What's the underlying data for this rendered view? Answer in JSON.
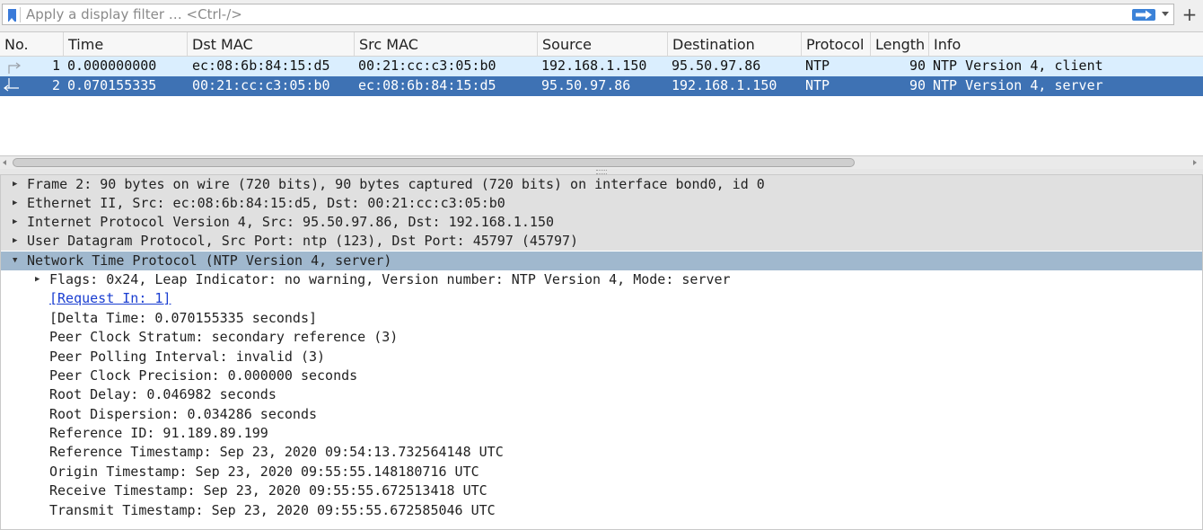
{
  "filter": {
    "placeholder": "Apply a display filter … <Ctrl-/>",
    "value": ""
  },
  "packet_list": {
    "columns": [
      "No.",
      "Time",
      "Dst MAC",
      "Src MAC",
      "Source",
      "Destination",
      "Protocol",
      "Length",
      "Info"
    ],
    "rows": [
      {
        "no": "1",
        "time": "0.000000000",
        "dst_mac": "ec:08:6b:84:15:d5",
        "src_mac": "00:21:cc:c3:05:b0",
        "source": "192.168.1.150",
        "destination": "95.50.97.86",
        "protocol": "NTP",
        "length": "90",
        "info": "NTP Version 4, client",
        "selected": false
      },
      {
        "no": "2",
        "time": "0.070155335",
        "dst_mac": "00:21:cc:c3:05:b0",
        "src_mac": "ec:08:6b:84:15:d5",
        "source": "95.50.97.86",
        "destination": "192.168.1.150",
        "protocol": "NTP",
        "length": "90",
        "info": "NTP Version 4, server",
        "selected": true
      }
    ]
  },
  "details": {
    "top_items": [
      "Frame 2: 90 bytes on wire (720 bits), 90 bytes captured (720 bits) on interface bond0, id 0",
      "Ethernet II, Src: ec:08:6b:84:15:d5, Dst: 00:21:cc:c3:05:b0",
      "Internet Protocol Version 4, Src: 95.50.97.86, Dst: 192.168.1.150",
      "User Datagram Protocol, Src Port: ntp (123), Dst Port: 45797 (45797)",
      "Network Time Protocol (NTP Version 4, server)"
    ],
    "ntp_children": [
      "Flags: 0x24, Leap Indicator: no warning, Version number: NTP Version 4, Mode: server",
      "[Request In: 1]",
      "[Delta Time: 0.070155335 seconds]",
      "Peer Clock Stratum: secondary reference (3)",
      "Peer Polling Interval: invalid (3)",
      "Peer Clock Precision: 0.000000 seconds",
      "Root Delay: 0.046982 seconds",
      "Root Dispersion: 0.034286 seconds",
      "Reference ID: 91.189.89.199",
      "Reference Timestamp: Sep 23, 2020 09:54:13.732564148 UTC",
      "Origin Timestamp: Sep 23, 2020 09:55:55.148180716 UTC",
      "Receive Timestamp: Sep 23, 2020 09:55:55.672513418 UTC",
      "Transmit Timestamp: Sep 23, 2020 09:55:55.672585046 UTC"
    ]
  },
  "colors": {
    "selected_row": "#3e72b4",
    "client_row": "#daeefe",
    "selected_tree_item": "#a0b8ce",
    "link": "#1a3ed1"
  },
  "icons": {
    "bookmark": "bookmark-icon",
    "apply": "apply-filter-arrow-icon",
    "dropdown": "chevron-down-icon",
    "add": "plus-icon",
    "request": "related-packet-request-icon",
    "response": "related-packet-response-icon"
  },
  "labels": {
    "add_filter": "+"
  }
}
